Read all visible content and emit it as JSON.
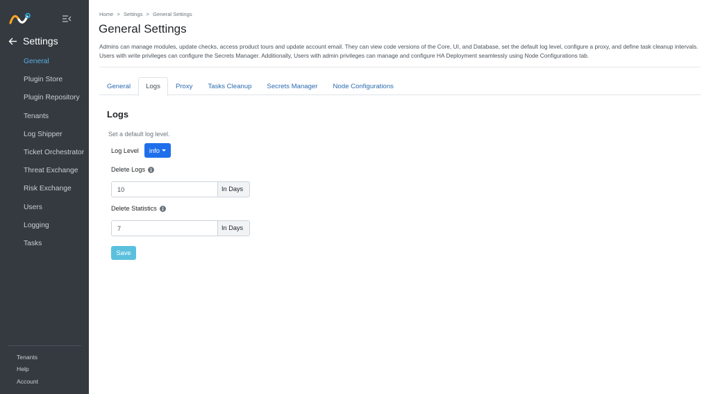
{
  "colors": {
    "sidebar_bg": "#343a40",
    "active_nav": "#5aaee4",
    "primary": "#1f6feb",
    "save_button": "#5bc0de",
    "tab_link": "#2b6cb0"
  },
  "sidebar": {
    "logo_icon": "brand-logo-icon",
    "collapse_icon": "sidebar-collapse-icon",
    "back_label": "Settings",
    "items": [
      {
        "label": "General",
        "active": true
      },
      {
        "label": "Plugin Store"
      },
      {
        "label": "Plugin Repository"
      },
      {
        "label": "Tenants"
      },
      {
        "label": "Log Shipper"
      },
      {
        "label": "Ticket Orchestrator"
      },
      {
        "label": "Threat Exchange"
      },
      {
        "label": "Risk Exchange"
      },
      {
        "label": "Users"
      },
      {
        "label": "Logging"
      },
      {
        "label": "Tasks"
      }
    ],
    "footer": [
      {
        "label": "Tenants"
      },
      {
        "label": "Help"
      },
      {
        "label": "Account"
      }
    ]
  },
  "breadcrumb": [
    "Home",
    ">",
    "Settings",
    ">",
    "General Settings"
  ],
  "page": {
    "title": "General Settings",
    "description": "Admins can manage modules, update checks, access product tours and update account email. They can view code versions of the Core, UI, and Database, set the default log level, configure a proxy, and define task cleanup intervals. Users with write privileges can configure the Secrets Manager. Additionally, Users with admin privileges can manage and configure HA Deployment seamlessly using Node Configurations tab."
  },
  "tabs": [
    {
      "label": "General"
    },
    {
      "label": "Logs",
      "active": true
    },
    {
      "label": "Proxy"
    },
    {
      "label": "Tasks Cleanup"
    },
    {
      "label": "Secrets Manager"
    },
    {
      "label": "Node Configurations"
    }
  ],
  "logs": {
    "title": "Logs",
    "hint": "Set a default log level.",
    "log_level_label": "Log Level",
    "log_level_value": "info",
    "delete_logs_label": "Delete Logs",
    "delete_logs_value": "10",
    "delete_logs_unit": "In Days",
    "delete_stats_label": "Delete Statistics",
    "delete_stats_value": "7",
    "delete_stats_unit": "In Days",
    "save_label": "Save"
  }
}
